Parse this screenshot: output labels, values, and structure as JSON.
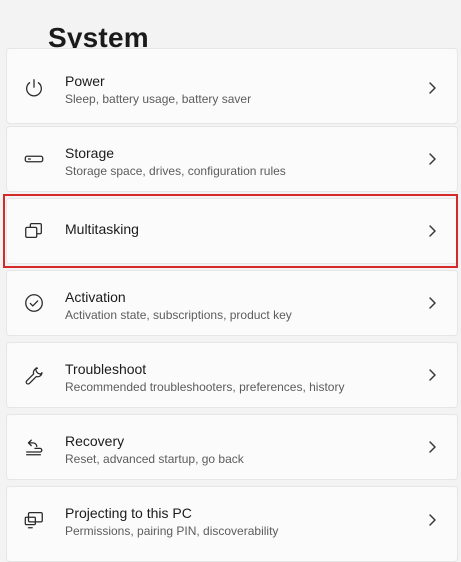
{
  "page": {
    "title": "System"
  },
  "items": [
    {
      "title": "Power",
      "subtitle": "Sleep, battery usage, battery saver",
      "icon": "power-icon"
    },
    {
      "title": "Storage",
      "subtitle": "Storage space, drives, configuration rules",
      "icon": "storage-icon"
    },
    {
      "title": "Multitasking",
      "subtitle": "",
      "icon": "multitasking-icon"
    },
    {
      "title": "Activation",
      "subtitle": "Activation state, subscriptions, product key",
      "icon": "activation-check-icon"
    },
    {
      "title": "Troubleshoot",
      "subtitle": "Recommended troubleshooters, preferences, history",
      "icon": "wrench-icon"
    },
    {
      "title": "Recovery",
      "subtitle": "Reset, advanced startup, go back",
      "icon": "recovery-icon"
    },
    {
      "title": "Projecting to this PC",
      "subtitle": "Permissions, pairing PIN, discoverability",
      "icon": "projecting-icon"
    }
  ],
  "highlight": {
    "target": "Multitasking",
    "color": "#d62a2a"
  }
}
